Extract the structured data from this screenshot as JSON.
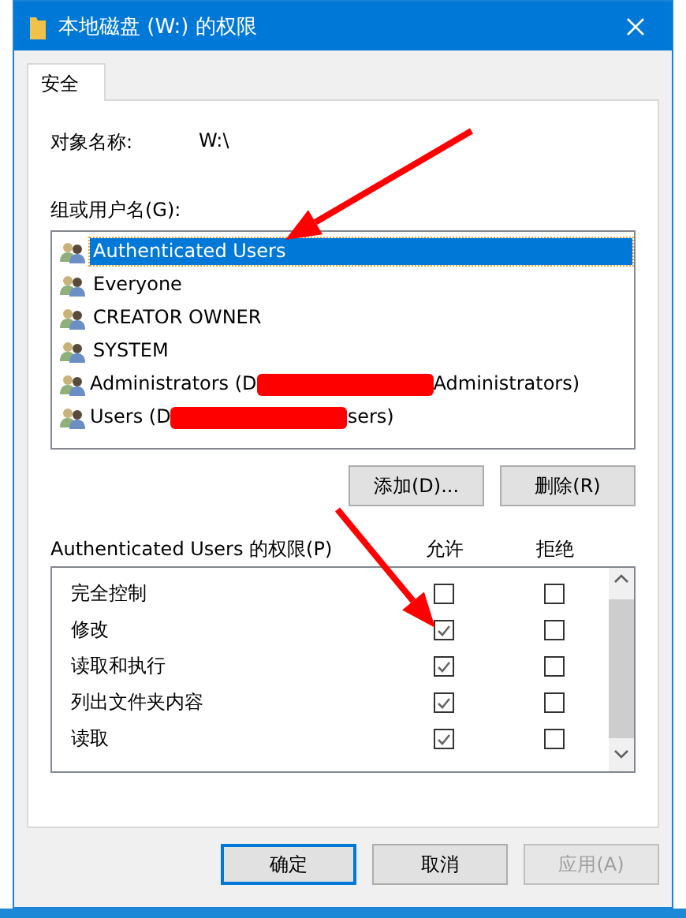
{
  "window": {
    "title": "本地磁盘 (W:) 的权限"
  },
  "tabs": [
    {
      "label": "安全",
      "selected": true
    }
  ],
  "object_name": {
    "label": "对象名称:",
    "value": "W:\\"
  },
  "groups": {
    "label": "组或用户名(G):",
    "items": [
      {
        "name": "Authenticated Users",
        "selected": true
      },
      {
        "name": "Everyone",
        "selected": false
      },
      {
        "name": "CREATOR OWNER",
        "selected": false
      },
      {
        "name": "SYSTEM",
        "selected": false
      },
      {
        "name": "Administrators (D",
        "redacted": true,
        "suffix": "Administrators)",
        "selected": false
      },
      {
        "name": "Users (D",
        "redacted": true,
        "suffix": "sers)",
        "selected": false
      }
    ]
  },
  "group_buttons": [
    "添加(D)...",
    "删除(R)"
  ],
  "permissions": {
    "label": "Authenticated Users 的权限(P)",
    "allow_header": "允许",
    "deny_header": "拒绝",
    "items": [
      {
        "name": "完全控制",
        "allow": false,
        "deny": false
      },
      {
        "name": "修改",
        "allow": true,
        "deny": false
      },
      {
        "name": "读取和执行",
        "allow": true,
        "deny": false
      },
      {
        "name": "列出文件夹内容",
        "allow": true,
        "deny": false
      },
      {
        "name": "读取",
        "allow": true,
        "deny": false
      }
    ]
  },
  "dialog_buttons": [
    {
      "label": "确定",
      "default": true,
      "disabled": false
    },
    {
      "label": "取消",
      "default": false,
      "disabled": false
    },
    {
      "label": "应用(A)",
      "default": false,
      "disabled": true
    }
  ],
  "annotations": [
    {
      "kind": "arrow"
    },
    {
      "kind": "arrow"
    }
  ]
}
